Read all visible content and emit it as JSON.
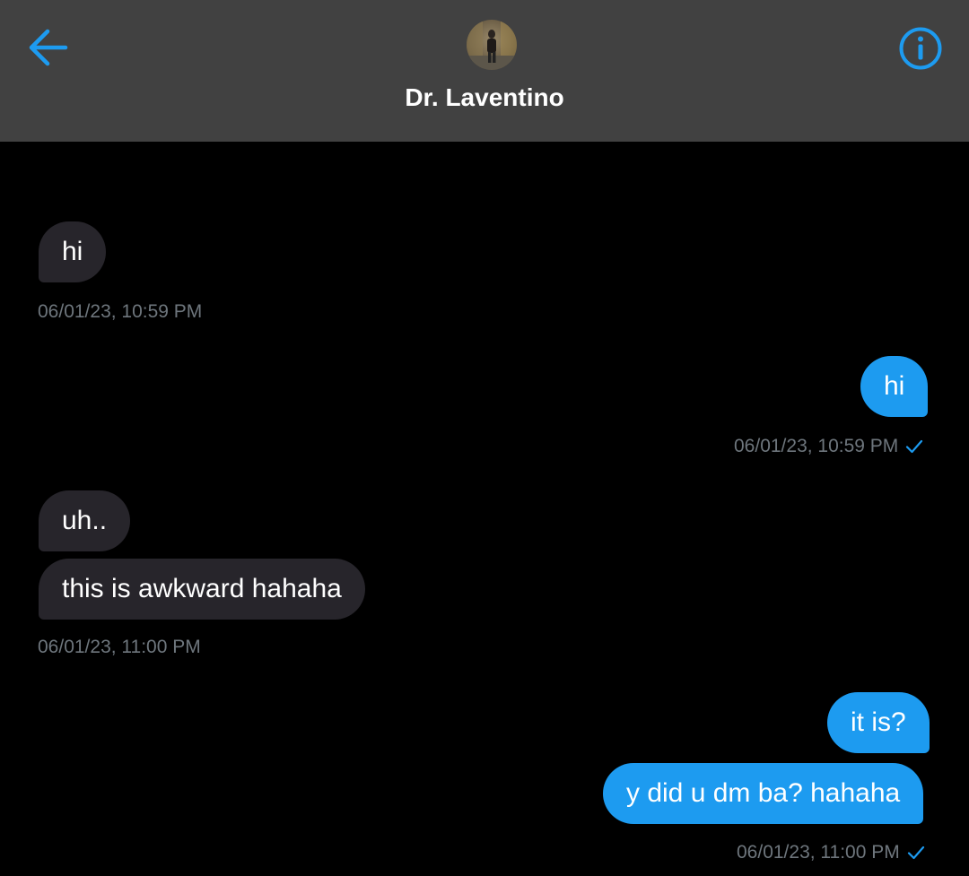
{
  "header": {
    "contact_name": "Dr. Laventino",
    "back_icon": "arrow-left-icon",
    "info_icon": "info-circle-icon",
    "accent_color": "#1d9bf0",
    "background": "#414141"
  },
  "messages": [
    {
      "direction": "incoming",
      "text": "hi"
    },
    {
      "direction": "incoming",
      "timestamp": "06/01/23, 10:59 PM"
    },
    {
      "direction": "outgoing",
      "text": "hi"
    },
    {
      "direction": "outgoing",
      "timestamp": "06/01/23, 10:59 PM",
      "status_icon": "check-icon"
    },
    {
      "direction": "incoming",
      "text": "uh.."
    },
    {
      "direction": "incoming",
      "text": "this is awkward hahaha"
    },
    {
      "direction": "incoming",
      "timestamp": "06/01/23, 11:00 PM"
    },
    {
      "direction": "outgoing",
      "text": "it is?"
    },
    {
      "direction": "outgoing",
      "text": "y did u dm ba? hahaha"
    },
    {
      "direction": "outgoing",
      "timestamp": "06/01/23, 11:00 PM",
      "status_icon": "check-icon"
    }
  ],
  "colors": {
    "incoming_bubble": "#27252b",
    "outgoing_bubble": "#1d9bf0",
    "timestamp": "#6e767d"
  }
}
